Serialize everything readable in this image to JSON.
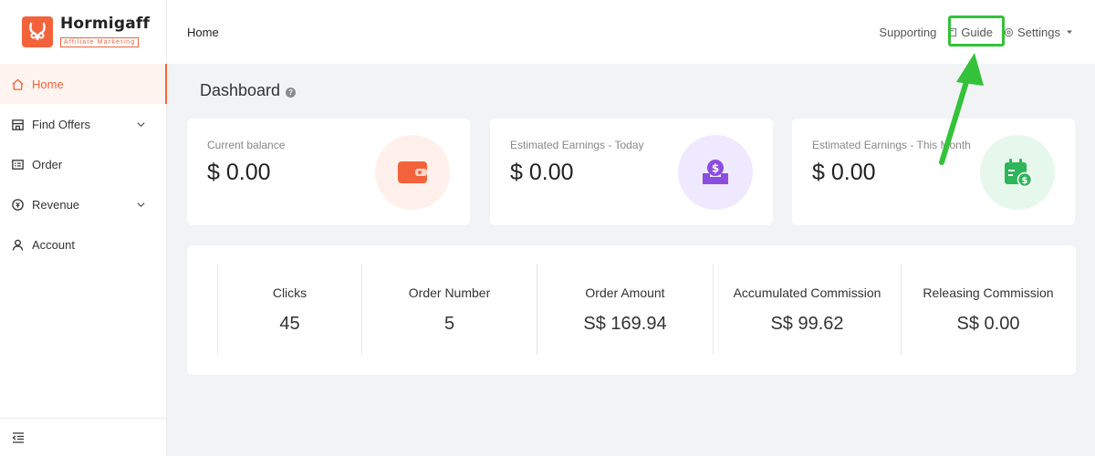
{
  "logo": {
    "name": "Hormigaff",
    "tagline": "Affiliate Marketing"
  },
  "sidebar": {
    "items": [
      {
        "label": "Home",
        "icon": "home-icon",
        "active": true
      },
      {
        "label": "Find Offers",
        "icon": "store-icon",
        "expandable": true
      },
      {
        "label": "Order",
        "icon": "order-icon"
      },
      {
        "label": "Revenue",
        "icon": "revenue-icon",
        "expandable": true
      },
      {
        "label": "Account",
        "icon": "user-icon"
      }
    ],
    "collapse_icon": "menu-collapse-icon"
  },
  "header": {
    "breadcrumb": "Home",
    "supporting": "Supporting",
    "guide": "Guide",
    "settings": "Settings"
  },
  "main": {
    "title": "Dashboard",
    "help": "?",
    "cards": [
      {
        "label": "Current balance",
        "value": "$ 0.00",
        "icon": "wallet-icon",
        "color": "#f2633b",
        "bg": "#fff0eb"
      },
      {
        "label": "Estimated Earnings - Today",
        "value": "$ 0.00",
        "icon": "money-tray-icon",
        "color": "#8b4de0",
        "bg": "#efe9ff"
      },
      {
        "label": "Estimated Earnings - This Month",
        "value": "$ 0.00",
        "icon": "calendar-dollar-icon",
        "color": "#2fb55a",
        "bg": "#e6f8ec"
      }
    ],
    "stats": [
      {
        "label": "Clicks",
        "value": "45"
      },
      {
        "label": "Order Number",
        "value": "5"
      },
      {
        "label": "Order Amount",
        "value": "S$ 169.94"
      },
      {
        "label": "Accumulated Commission",
        "value": "S$ 99.62"
      },
      {
        "label": "Releasing Commission",
        "value": "S$ 0.00"
      }
    ]
  },
  "annotation": {
    "color": "#33c23a"
  }
}
